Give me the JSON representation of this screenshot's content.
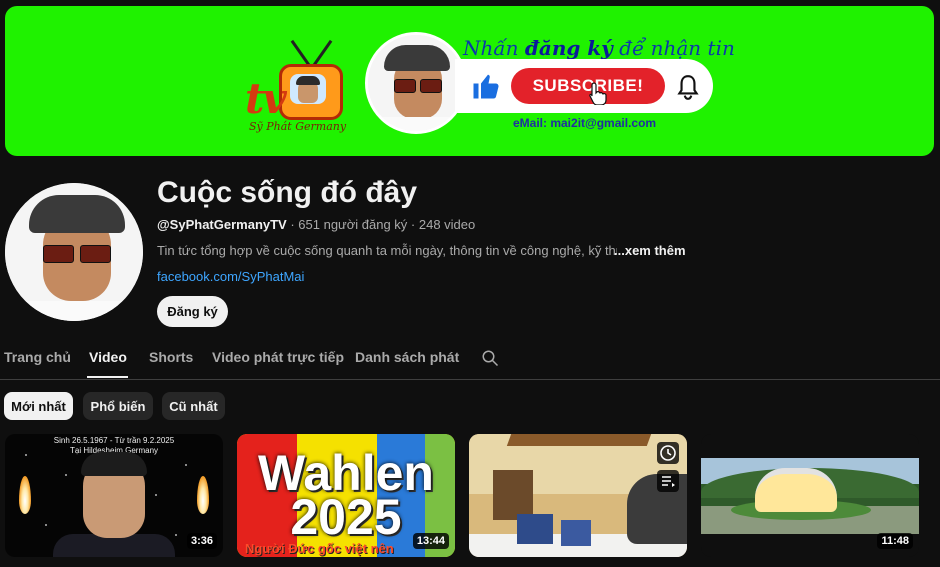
{
  "banner": {
    "logo_text": "tv",
    "logo_caption": "Sỹ Phát Germany",
    "headline_prefix": "Nhấn ",
    "headline_bold": "đăng ký",
    "headline_suffix": " để nhận tin",
    "subscribe_label": "SUBSCRIBE!",
    "email": "eMail: mai2it@gmail.com"
  },
  "channel": {
    "title": "Cuộc sống đó đây",
    "handle": "@SyPhatGermanyTV",
    "meta": " · 651 người đăng ký · 248 video",
    "description": "Tin tức tổng hợp về cuộc sống quanh ta mỗi ngày,  thông tin  về công nghệ, kỹ thuật,",
    "more": "...xem thêm",
    "link": "facebook.com/SyPhatMai",
    "subscribe_label": "Đăng ký"
  },
  "tabs": [
    {
      "label": "Trang chủ",
      "active": false
    },
    {
      "label": "Video",
      "active": true
    },
    {
      "label": "Shorts",
      "active": false
    },
    {
      "label": "Video phát trực tiếp",
      "active": false
    },
    {
      "label": "Danh sách phát",
      "active": false
    }
  ],
  "chips": [
    {
      "label": "Mới nhất",
      "active": true
    },
    {
      "label": "Phổ biến",
      "active": false
    },
    {
      "label": "Cũ nhất",
      "active": false
    }
  ],
  "videos": [
    {
      "duration": "3:36",
      "caption_line1": "Sinh 26.5.1967 - Từ trần 9.2.2025",
      "caption_line2": "Tại Hildesheim Germany"
    },
    {
      "duration": "13:44",
      "title_line1": "Wahlen",
      "title_line2": "2025",
      "subtitle": "Người Đức gốc việt nên"
    },
    {
      "duration": ""
    },
    {
      "duration": "11:48"
    }
  ],
  "icons": {
    "like": "thumbs-up-icon",
    "bell": "bell-icon",
    "cursor": "hand-cursor-icon",
    "search": "search-icon",
    "watch_later": "clock-icon",
    "add_queue": "queue-icon"
  },
  "colors": {
    "banner_bg": "#1ff200",
    "subscribe_red": "#e3222a",
    "link_blue": "#3ea6ff",
    "page_bg": "#0f0f0f"
  }
}
